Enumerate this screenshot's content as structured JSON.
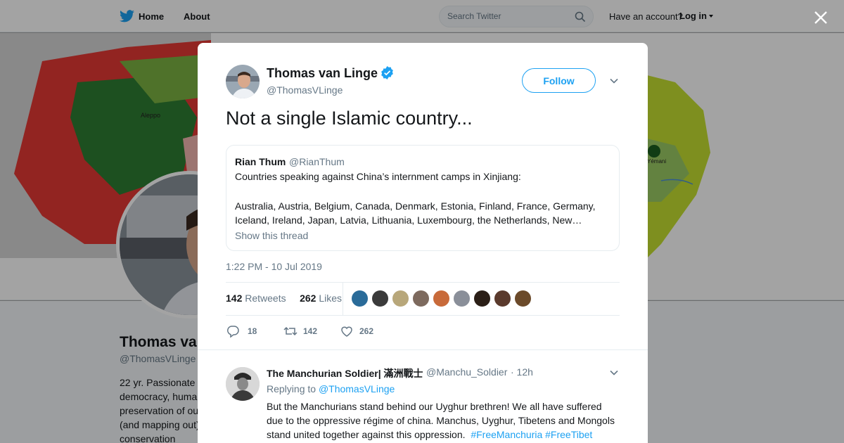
{
  "topbar": {
    "home_label": "Home",
    "about_label": "About",
    "search_placeholder": "Search Twitter",
    "have_account": "Have an account?",
    "login_label": "Log in"
  },
  "background_profile": {
    "name": "Thomas va",
    "handle": "@ThomasVLinge",
    "bio_lines": [
      "22 yr. Passionate",
      "democracy, huma",
      "preservation of ou",
      "(and mapping out)",
      "conservation"
    ],
    "map_labels": {
      "aleppo": "Aleppo",
      "yemani": "Yémani"
    }
  },
  "tweet": {
    "author_name": "Thomas van Linge",
    "author_handle": "@ThomasVLinge",
    "follow_label": "Follow",
    "text": "Not a single Islamic country...",
    "quoted": {
      "name": "Rian Thum",
      "handle": "@RianThum",
      "line1": "Countries speaking against China’s internment camps in Xinjiang:",
      "line2": "Australia, Austria, Belgium, Canada, Denmark, Estonia, Finland, France, Germany, Iceland, Ireland, Japan, Latvia, Lithuania, Luxembourg, the Netherlands, New…",
      "show_thread": "Show this thread"
    },
    "timestamp": "1:22 PM - 10 Jul 2019",
    "retweets_count": "142",
    "retweets_label": "Retweets",
    "likes_count": "262",
    "likes_label": "Likes",
    "actions": {
      "replies": "18",
      "retweets": "142",
      "likes": "262"
    }
  },
  "reply": {
    "name": "The Manchurian Soldier| 滿洲戰士",
    "handle": "@Manchu_Soldier",
    "time": "· 12h",
    "replying_prefix": "Replying to",
    "replying_to": "@ThomasVLinge",
    "body": "But the Manchurians stand behind our Uyghur brethren! We all have suffered due to the oppressive régime of china. Manchus, Uyghur, Tibetens and Mongols stand united together against this oppression.",
    "hashtag1": "#FreeManchuria",
    "hashtag2": "#FreeTibet"
  },
  "colors": {
    "twitter_blue": "#1da1f2",
    "text_dark": "#14171a",
    "text_gray": "#657786",
    "border": "#e6ecf0"
  }
}
